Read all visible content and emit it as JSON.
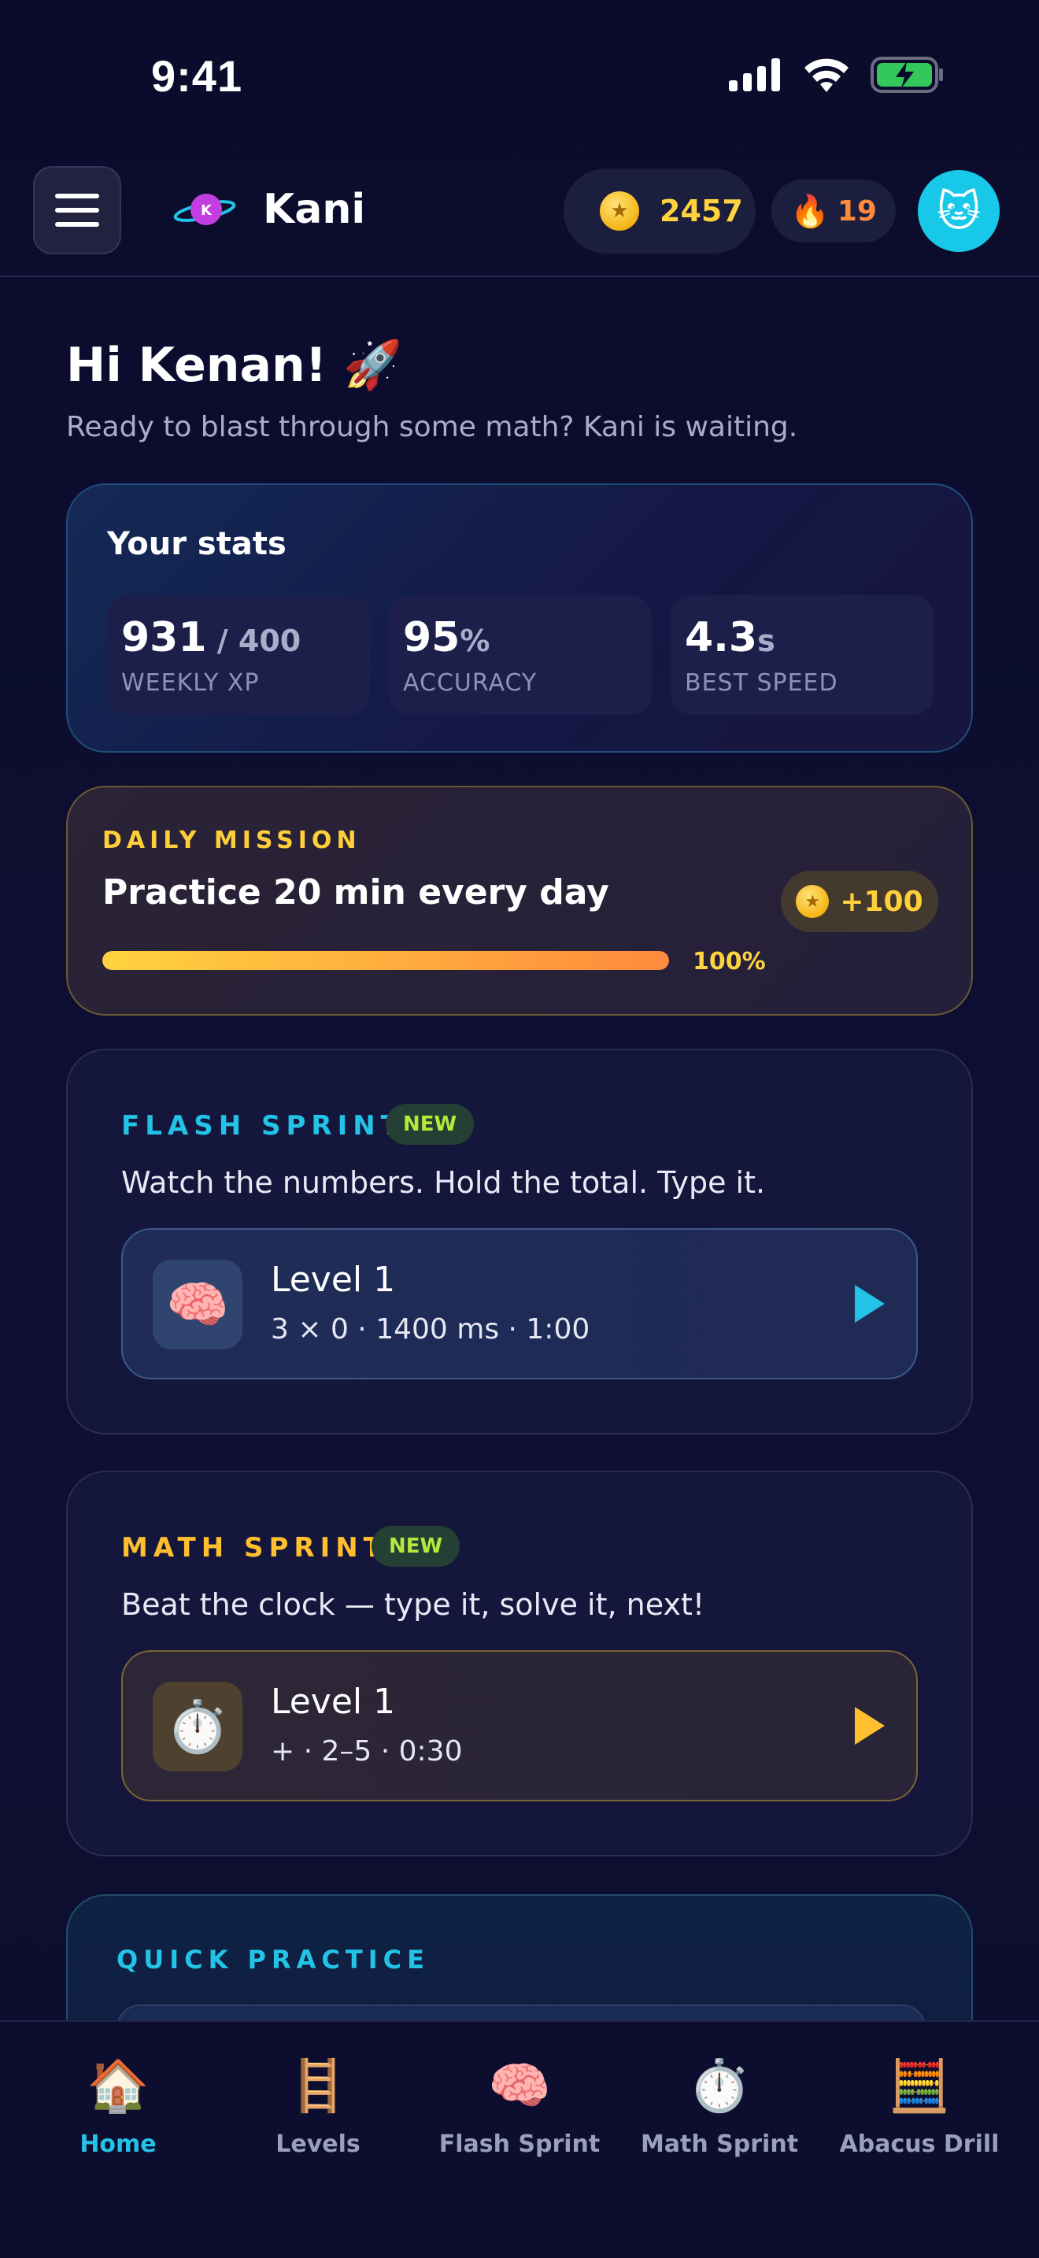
{
  "status": {
    "time": "9:41"
  },
  "header": {
    "brand": "Kani",
    "coins": "2457",
    "streak": "19",
    "avatar_emoji": "🐱",
    "streak_emoji": "🔥"
  },
  "greeting": {
    "title": "Hi Kenan! 🚀",
    "subtitle": "Ready to blast through some math? Kani is waiting."
  },
  "stats": {
    "title": "Your stats",
    "items": [
      {
        "value": "931",
        "suffix": " / 400",
        "label": "WEEKLY XP"
      },
      {
        "value": "95",
        "suffix": "%",
        "label": "ACCURACY"
      },
      {
        "value": "4.3",
        "suffix": "s",
        "label": "BEST SPEED"
      }
    ]
  },
  "mission": {
    "kicker": "DAILY MISSION",
    "title": "Practice 20 min every day",
    "progress": 1.0,
    "progress_label": "100%",
    "reward": "+100"
  },
  "flash_sprint": {
    "kicker": "FLASH SPRINT",
    "badge": "NEW",
    "description": "Watch the numbers. Hold the total. Type it.",
    "level_name": "Level 1",
    "level_meta": "3 × 0 · 1400 ms · 1:00",
    "icon_emoji": "🧠",
    "accent": "#22c3e6"
  },
  "math_sprint": {
    "kicker": "MATH SPRINT",
    "badge": "NEW",
    "description": "Beat the clock — type it, solve it, next!",
    "level_name": "Level 1",
    "level_meta": "+ · 2–5 · 0:30",
    "icon_emoji": "⏱️",
    "accent": "#ffbf2e"
  },
  "quick_practice": {
    "kicker": "QUICK PRACTICE"
  },
  "nav": {
    "items": [
      {
        "label": "Home",
        "emoji": "🏠",
        "active": true
      },
      {
        "label": "Levels",
        "emoji": "🪜",
        "active": false
      },
      {
        "label": "Flash Sprint",
        "emoji": "🧠",
        "active": false
      },
      {
        "label": "Math Sprint",
        "emoji": "⏱️",
        "active": false
      },
      {
        "label": "Abacus Drill",
        "emoji": "🧮",
        "active": false
      }
    ]
  },
  "colors": {
    "background": "#0c0d2e",
    "accent_cyan": "#22c3e6",
    "accent_gold": "#ffd23f",
    "accent_orange": "#ff8a3d"
  }
}
